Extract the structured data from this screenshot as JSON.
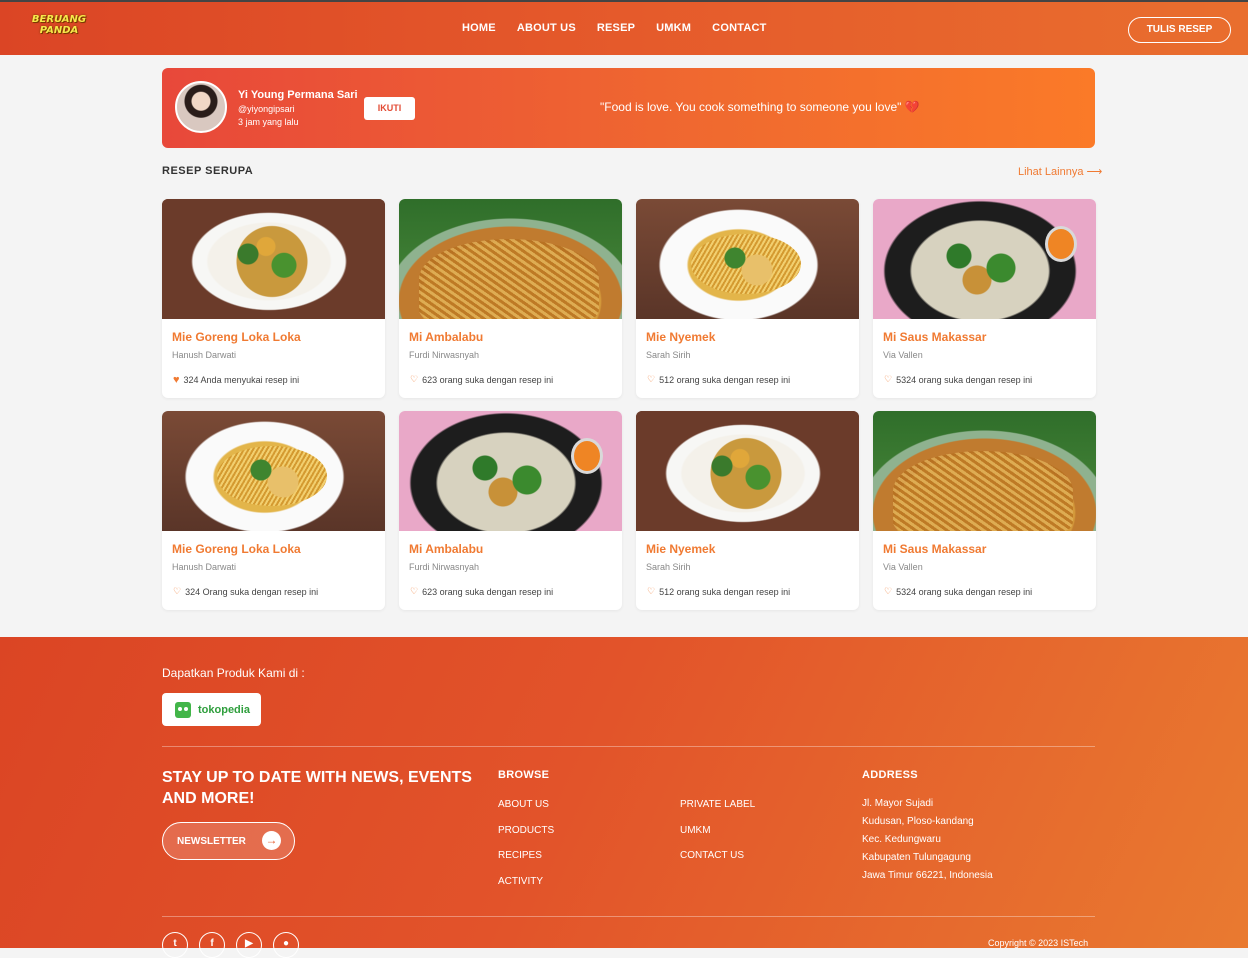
{
  "header": {
    "logo": "BERUANG PANDA",
    "nav": [
      "HOME",
      "ABOUT US",
      "RESEP",
      "UMKM",
      "CONTACT"
    ],
    "cta": "TULIS RESEP"
  },
  "author": {
    "name": "Yi Young Permana Sari",
    "handle": "@yiyongipsari",
    "time": "3 jam yang lalu",
    "follow_label": "IKUTI",
    "quote": "\"Food is love. You cook something to someone you love\"",
    "quote_emoji": "💔"
  },
  "similar": {
    "title": "RESEP SERUPA",
    "more": "Lihat Lainnya ⟶",
    "cards": [
      {
        "title": "Mie Goreng Loka Loka",
        "author": "Hanush Darwati",
        "likes": "324 Anda menyukai resep ini",
        "liked": true,
        "image": "a"
      },
      {
        "title": "Mi Ambalabu",
        "author": "Furdi Nirwasnyah",
        "likes": "623 orang suka dengan resep ini",
        "liked": false,
        "image": "b"
      },
      {
        "title": "Mie Nyemek",
        "author": "Sarah Sirih",
        "likes": "512 orang suka dengan resep ini",
        "liked": false,
        "image": "c"
      },
      {
        "title": "Mi Saus Makassar",
        "author": "Via Vallen",
        "likes": "5324 orang suka dengan resep ini",
        "liked": false,
        "image": "d"
      },
      {
        "title": "Mie Goreng Loka Loka",
        "author": "Hanush Darwati",
        "likes": "324 Orang suka dengan resep ini",
        "liked": false,
        "image": "c"
      },
      {
        "title": "Mi Ambalabu",
        "author": "Furdi Nirwasnyah",
        "likes": "623 orang suka dengan resep ini",
        "liked": false,
        "image": "d"
      },
      {
        "title": "Mie Nyemek",
        "author": "Sarah Sirih",
        "likes": "512 orang suka dengan resep ini",
        "liked": false,
        "image": "a"
      },
      {
        "title": "Mi Saus Makassar",
        "author": "Via Vallen",
        "likes": "5324 orang suka dengan resep ini",
        "liked": false,
        "image": "b"
      }
    ]
  },
  "footer": {
    "get_products": "Dapatkan Produk Kami di :",
    "store": "tokopedia",
    "stay_title": "STAY UP TO DATE WITH NEWS, EVENTS AND MORE!",
    "newsletter": "NEWSLETTER",
    "browse_title": "BROWSE",
    "browse_col1": [
      "ABOUT US",
      "PRODUCTS",
      "RECIPES",
      "ACTIVITY"
    ],
    "browse_col2": [
      "PRIVATE LABEL",
      "UMKM",
      "CONTACT US"
    ],
    "address_title": "ADDRESS",
    "address_lines": [
      "Jl. Mayor Sujadi",
      "Kudusan, Ploso-kandang",
      "Kec. Kedungwaru",
      "Kabupaten Tulungagung",
      "Jawa Timur 66221, Indonesia"
    ],
    "socials": [
      "twitter-icon",
      "facebook-icon",
      "youtube-icon",
      "chat-icon"
    ],
    "copyright": "Copyright © 2023 ISTech"
  },
  "colors": {
    "accent": "#f07a32",
    "primary": "#e34b34"
  }
}
